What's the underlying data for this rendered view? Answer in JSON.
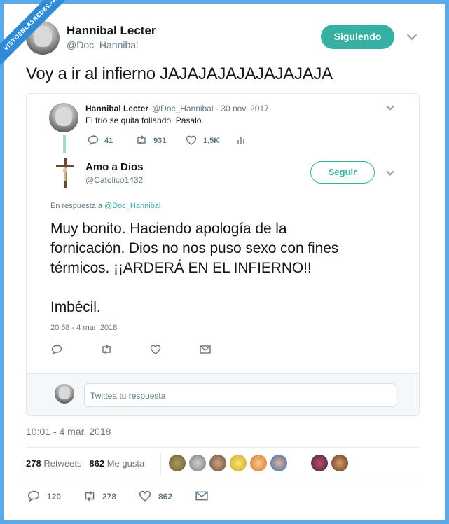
{
  "watermark": {
    "text": "VISTOENLASREDES",
    "suffix": ".com"
  },
  "tweet": {
    "author_name": "Hannibal Lecter",
    "author_handle": "@Doc_Hannibal",
    "follow_label": "Siguiendo",
    "text": "Voy a ir al infierno JAJAJAJAJAJAJAJAJA",
    "timestamp": "10:01 - 4 mar. 2018",
    "retweets_count": "278",
    "retweets_label": "Retweets",
    "likes_count": "862",
    "likes_label": "Me gusta",
    "actions": {
      "replies": "120",
      "retweets": "278",
      "likes": "862"
    }
  },
  "quoted": {
    "original": {
      "author_name": "Hannibal Lecter",
      "author_handle": "@Doc_Hannibal",
      "date": "· 30 nov. 2017",
      "text": "El frío se quita follando. Pásalo.",
      "replies": "41",
      "retweets": "931",
      "likes": "1,5K"
    },
    "reply": {
      "author_name": "Amo a Dios",
      "author_handle": "@Catolico1432",
      "follow_label": "Seguir",
      "in_reply_prefix": "En respuesta a",
      "in_reply_handle": "@Doc_Hannibal",
      "text_line1": "Muy bonito. Haciendo apología de la",
      "text_line2": "fornicación. Dios no nos puso sexo con fines",
      "text_line3": "térmicos. ¡¡ARDERÁ EN EL INFIERNO!!",
      "text_line4": "Imbécil.",
      "timestamp": "20:58 - 4 mar. 2018"
    },
    "reply_placeholder": "Twittea tu respuesta"
  },
  "colors": {
    "accent": "#36b0a3",
    "frame": "#5ba9e6",
    "muted": "#657786"
  }
}
